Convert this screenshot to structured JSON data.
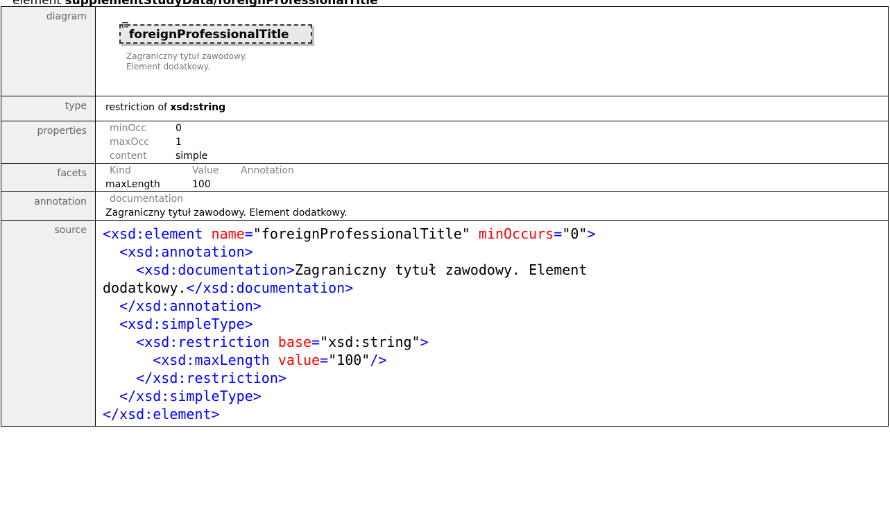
{
  "header": {
    "keyword": "element",
    "path": "supplementStudyData/foreignProfessionalTitle"
  },
  "rows": {
    "diagram": {
      "label": "diagram",
      "element_name": "foreignProfessionalTitle",
      "doc_line1": "Zagraniczny tytuł zawodowy.",
      "doc_line2": "Element dodatkowy."
    },
    "type": {
      "label": "type",
      "prefix": "restriction of",
      "base": "xsd:string"
    },
    "properties": {
      "label": "properties",
      "items": [
        {
          "key": "minOcc",
          "value": "0"
        },
        {
          "key": "maxOcc",
          "value": "1"
        },
        {
          "key": "content",
          "value": "simple"
        }
      ]
    },
    "facets": {
      "label": "facets",
      "headers": [
        "Kind",
        "Value",
        "Annotation"
      ],
      "rows": [
        {
          "kind": "maxLength",
          "value": "100",
          "annotation": ""
        }
      ]
    },
    "annotation": {
      "label": "annotation",
      "head": "documentation",
      "text": "Zagraniczny tytuł zawodowy. Element dodatkowy."
    },
    "source": {
      "label": "source",
      "tag_open_element": "<xsd:element",
      "attr_name": "name",
      "val_name": "\"foreignProfessionalTitle\"",
      "attr_minOccurs": "minOccurs",
      "val_minOccurs": "\"0\"",
      "gt": ">",
      "eq": "=",
      "tag_annotation_open": "<xsd:annotation>",
      "tag_documentation_open": "<xsd:documentation>",
      "doc_text_line1": "Zagraniczny tytuł zawodowy. Element",
      "doc_text_line2": "dodatkowy.",
      "tag_documentation_close": "</xsd:documentation>",
      "tag_annotation_close": "</xsd:annotation>",
      "tag_simpletype_open": "<xsd:simpleType>",
      "tag_restriction_open": "<xsd:restriction",
      "attr_base": "base",
      "val_base": "\"xsd:string\"",
      "tag_maxlength_open": "<xsd:maxLength",
      "attr_value": "value",
      "val_value": "\"100\"",
      "self_close": "/>",
      "tag_restriction_close": "</xsd:restriction>",
      "tag_simpletype_close": "</xsd:simpleType>",
      "tag_element_close": "</xsd:element>"
    }
  },
  "colors": {
    "tag": "#0000ff",
    "attribute": "#ff0000",
    "label_bg": "#f0f0f0",
    "label_text": "#666666"
  },
  "icons": {
    "documentation": "documentation-lines-icon"
  }
}
